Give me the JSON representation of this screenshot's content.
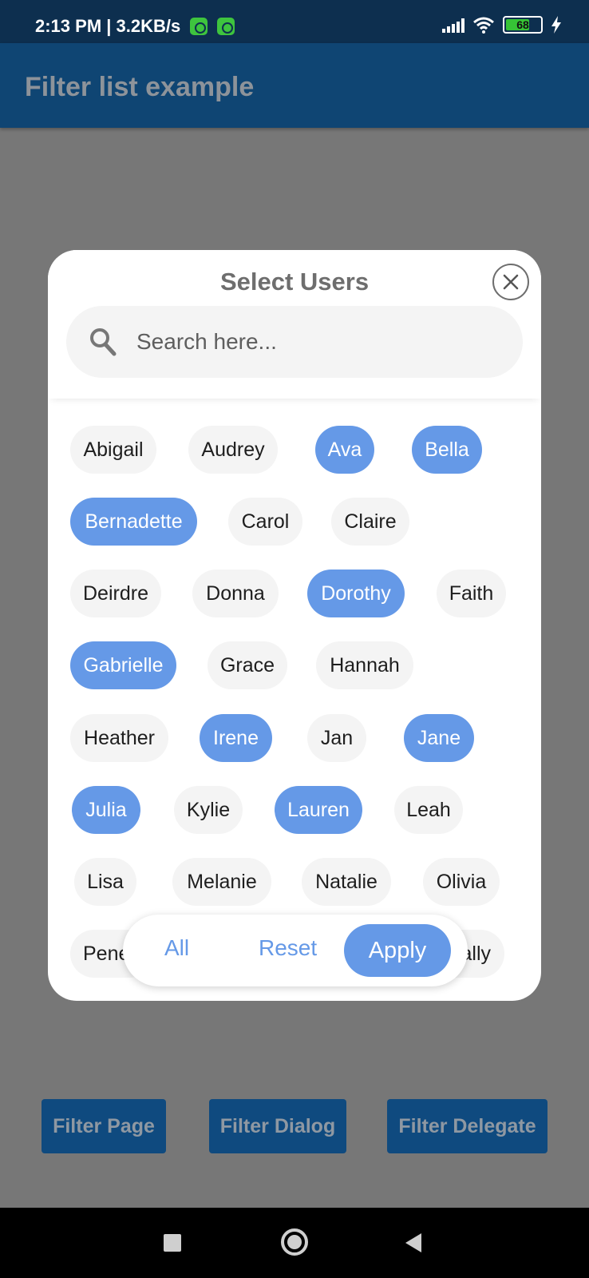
{
  "status_bar": {
    "time_speed": "2:13 PM | 3.2KB/s",
    "battery": "68"
  },
  "app_bar": {
    "title": "Filter list example"
  },
  "dialog": {
    "title": "Select Users",
    "search_placeholder": "Search here...",
    "chips": [
      {
        "label": "Abigail",
        "selected": false
      },
      {
        "label": "Audrey",
        "selected": false
      },
      {
        "label": "Ava",
        "selected": true
      },
      {
        "label": "Bella",
        "selected": true
      },
      {
        "label": "Bernadette",
        "selected": true
      },
      {
        "label": "Carol",
        "selected": false
      },
      {
        "label": "Claire",
        "selected": false
      },
      {
        "label": "Deirdre",
        "selected": false
      },
      {
        "label": "Donna",
        "selected": false
      },
      {
        "label": "Dorothy",
        "selected": true
      },
      {
        "label": "Faith",
        "selected": false
      },
      {
        "label": "Gabrielle",
        "selected": true
      },
      {
        "label": "Grace",
        "selected": false
      },
      {
        "label": "Hannah",
        "selected": false
      },
      {
        "label": "Heather",
        "selected": false
      },
      {
        "label": "Irene",
        "selected": true
      },
      {
        "label": "Jan",
        "selected": false
      },
      {
        "label": "Jane",
        "selected": true
      },
      {
        "label": "Julia",
        "selected": true
      },
      {
        "label": "Kylie",
        "selected": false
      },
      {
        "label": "Lauren",
        "selected": true
      },
      {
        "label": "Leah",
        "selected": false
      },
      {
        "label": "Lisa",
        "selected": false
      },
      {
        "label": "Melanie",
        "selected": false
      },
      {
        "label": "Natalie",
        "selected": false
      },
      {
        "label": "Olivia",
        "selected": false
      },
      {
        "label": "Pene",
        "selected": false
      },
      {
        "label": "ally",
        "selected": false
      }
    ],
    "actions": {
      "all": "All",
      "reset": "Reset",
      "apply": "Apply"
    }
  },
  "bottom_buttons": {
    "filter_page": "Filter Page",
    "filter_dialog": "Filter Dialog",
    "filter_delegate": "Filter Delegate"
  },
  "colors": {
    "accent": "#6599e7",
    "app_bar": "#0f4573",
    "scrim": "#777777"
  }
}
